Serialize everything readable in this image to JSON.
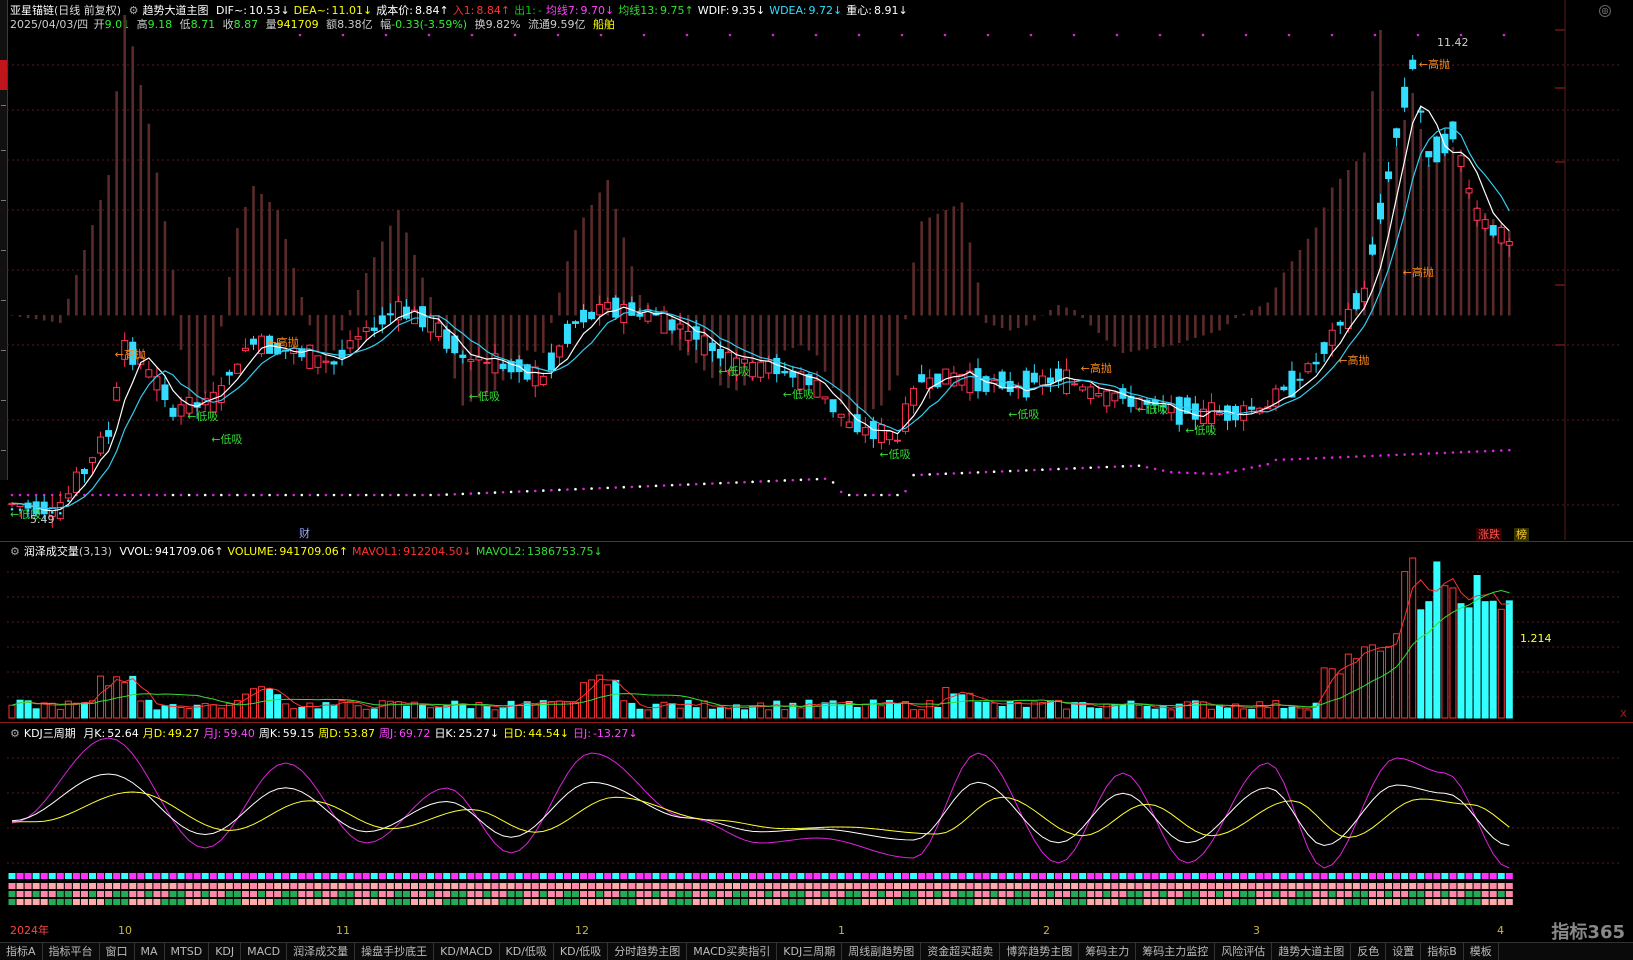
{
  "main_header": {
    "stock_name": "亚星锚链",
    "period": "(日线 前复权)",
    "indicator": "趋势大道主图",
    "items": [
      {
        "label": "DIF~:",
        "value": "10.53",
        "arrow": "↓",
        "color": "#ffffff"
      },
      {
        "label": "DEA~:",
        "value": "11.01",
        "arrow": "↓",
        "color": "#ffff00"
      },
      {
        "label": "成本价:",
        "value": "8.84",
        "arrow": "↑",
        "color": "#ffffff"
      },
      {
        "label": "入1:",
        "value": "8.84",
        "arrow": "↑",
        "color": "#ff3333"
      },
      {
        "label": "出1:",
        "value": "-",
        "arrow": "",
        "color": "#00cc00"
      },
      {
        "label": "均线7:",
        "value": "9.70",
        "arrow": "↓",
        "color": "#ff44ff"
      },
      {
        "label": "均线13:",
        "value": "9.75",
        "arrow": "↑",
        "color": "#33dd33"
      },
      {
        "label": "WDIF:",
        "value": "9.35",
        "arrow": "↓",
        "color": "#ffffff"
      },
      {
        "label": "WDEA:",
        "value": "9.72",
        "arrow": "↓",
        "color": "#33ddff"
      },
      {
        "label": "重心:",
        "value": "8.91",
        "arrow": "↓",
        "color": "#ffffff"
      }
    ]
  },
  "quote_line": {
    "date": "2025/04/03/四",
    "open_label": "开",
    "open": "9.01",
    "high_label": "高",
    "high": "9.18",
    "low_label": "低",
    "low": "8.71",
    "close_label": "收",
    "close": "8.87",
    "volume_label": "量",
    "volume": "941709",
    "amount_label": "额",
    "amount": "8.38亿",
    "change_label": "幅",
    "change": "-0.33(-3.59%)",
    "turnover_label": "换",
    "turnover": "9.82%",
    "float_label": "流通",
    "float": "9.59亿",
    "sector": "船舶"
  },
  "main_chart": {
    "max_label": "11.42",
    "min_label": "5.49",
    "signals": [
      {
        "text": "←低吸",
        "type": "buy"
      },
      {
        "text": "←高抛",
        "type": "sell"
      },
      {
        "text": "←低吸",
        "type": "buy"
      },
      {
        "text": "←低吸",
        "type": "buy"
      },
      {
        "text": "←高抛",
        "type": "sell"
      },
      {
        "text": "←低吸",
        "type": "buy"
      },
      {
        "text": "←低吸",
        "type": "buy"
      },
      {
        "text": "←低吸",
        "type": "buy"
      },
      {
        "text": "←低吸",
        "type": "buy"
      },
      {
        "text": "←高抛",
        "type": "sell"
      },
      {
        "text": "←低吸",
        "type": "buy"
      },
      {
        "text": "←低吸",
        "type": "buy"
      },
      {
        "text": "←低吸",
        "type": "buy"
      },
      {
        "text": "←高抛",
        "type": "sell"
      },
      {
        "text": "←高抛",
        "type": "sell"
      },
      {
        "text": "←高抛",
        "type": "sell"
      }
    ],
    "marker_cai": "财",
    "badge_zhangdie": "涨跌",
    "badge_bang": "榜"
  },
  "volume_panel": {
    "title": "润泽成交量",
    "params": "(3,13)",
    "items": [
      {
        "label": "VVOL:",
        "value": "941709.06",
        "arrow": "↑",
        "color": "#ffffff"
      },
      {
        "label": "VOLUME:",
        "value": "941709.06",
        "arrow": "↑",
        "color": "#ffff00"
      },
      {
        "label": "MAVOL1:",
        "value": "912204.50",
        "arrow": "↓",
        "color": "#ff3333"
      },
      {
        "label": "MAVOL2:",
        "value": "1386753.75",
        "arrow": "↓",
        "color": "#33dd33"
      }
    ],
    "right_label": "1.214"
  },
  "kdj_panel": {
    "title": "KDJ三周期",
    "items": [
      {
        "label": "月K:",
        "value": "52.64",
        "arrow": "",
        "color": "#ffffff"
      },
      {
        "label": "月D:",
        "value": "49.27",
        "arrow": "",
        "color": "#ffff00"
      },
      {
        "label": "月J:",
        "value": "59.40",
        "arrow": "",
        "color": "#ff44ff"
      },
      {
        "label": "周K:",
        "value": "59.15",
        "arrow": "",
        "color": "#ffffff"
      },
      {
        "label": "周D:",
        "value": "53.87",
        "arrow": "",
        "color": "#ffff00"
      },
      {
        "label": "周J:",
        "value": "69.72",
        "arrow": "",
        "color": "#ff44ff"
      },
      {
        "label": "日K:",
        "value": "25.27",
        "arrow": "↓",
        "color": "#ffffff"
      },
      {
        "label": "日D:",
        "value": "44.54",
        "arrow": "↓",
        "color": "#ffff00"
      },
      {
        "label": "日J:",
        "value": "-13.27",
        "arrow": "↓",
        "color": "#ff44ff"
      }
    ]
  },
  "time_axis": {
    "labels": [
      "2024年",
      "10",
      "11",
      "12",
      "1",
      "2",
      "3",
      "4"
    ]
  },
  "bottom_tabs": [
    "指标A",
    "指标平台",
    "窗口",
    "MA",
    "MTSD",
    "KDJ",
    "MACD",
    "润泽成交量",
    "操盘手抄底王",
    "KD/MACD",
    "KD/低吸",
    "KD/低吸",
    "分时趋势主图",
    "MACD买卖指引",
    "KDJ三周期",
    "周线副趋势图",
    "资金超买超卖",
    "博弈趋势主图",
    "筹码主力",
    "筹码主力监控",
    "风险评估",
    "趋势大道主图",
    "反色",
    "设置",
    "指标B",
    "模板"
  ],
  "logo_text": "指标365",
  "colors": {
    "up": "#ff3355",
    "down": "#33ddff",
    "buy_signal": "#33dd33",
    "sell_signal": "#ff8a1a",
    "dots": "#dd22dd",
    "grid": "#5a1a1a"
  }
}
